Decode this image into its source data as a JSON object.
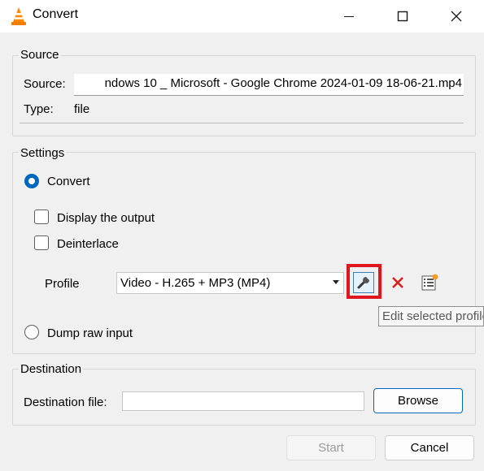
{
  "window": {
    "title": "Convert",
    "controls": {
      "minimize_icon": "minimize-icon",
      "maximize_icon": "maximize-icon",
      "close_icon": "close-icon"
    }
  },
  "source": {
    "group_title": "Source",
    "source_label": "Source:",
    "source_value": "ndows 10 _ Microsoft - Google Chrome 2024-01-09 18-06-21.mp4",
    "type_label": "Type:",
    "type_value": "file"
  },
  "settings": {
    "group_title": "Settings",
    "convert_label": "Convert",
    "convert_selected": true,
    "display_output_label": "Display the output",
    "display_output_checked": false,
    "deinterlace_label": "Deinterlace",
    "deinterlace_checked": false,
    "profile_label": "Profile",
    "profile_value": "Video - H.265 + MP3 (MP4)",
    "edit_profile_icon": "wrench-icon",
    "delete_profile_icon": "red-x-icon",
    "new_profile_icon": "new-profile-icon",
    "tooltip": "Edit selected profile",
    "dump_raw_label": "Dump raw input",
    "dump_raw_selected": false
  },
  "destination": {
    "group_title": "Destination",
    "file_label": "Destination file:",
    "file_value": "",
    "browse_label": "Browse"
  },
  "footer": {
    "start_label": "Start",
    "cancel_label": "Cancel"
  },
  "colors": {
    "accent": "#0067c0",
    "highlight_box": "#e0161f",
    "delete_red": "#d92121"
  }
}
